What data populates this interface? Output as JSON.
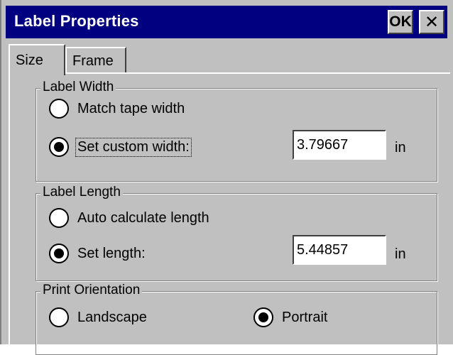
{
  "window": {
    "title": "Label Properties",
    "ok_label": "OK",
    "close_label": "✕"
  },
  "tabs": [
    {
      "label": "Size",
      "active": true
    },
    {
      "label": "Frame",
      "active": false
    }
  ],
  "label_width": {
    "title": "Label Width",
    "options": [
      {
        "label": "Match tape width",
        "selected": false
      },
      {
        "label": "Set custom width:",
        "selected": true
      }
    ],
    "value": "3.79667",
    "unit": "in"
  },
  "label_length": {
    "title": "Label Length",
    "options": [
      {
        "label": "Auto calculate length",
        "selected": false
      },
      {
        "label": "Set length:",
        "selected": true
      }
    ],
    "value": "5.44857",
    "unit": "in"
  },
  "print_orientation": {
    "title": "Print Orientation",
    "options": [
      {
        "label": "Landscape",
        "selected": false
      },
      {
        "label": "Portrait",
        "selected": true
      }
    ]
  }
}
